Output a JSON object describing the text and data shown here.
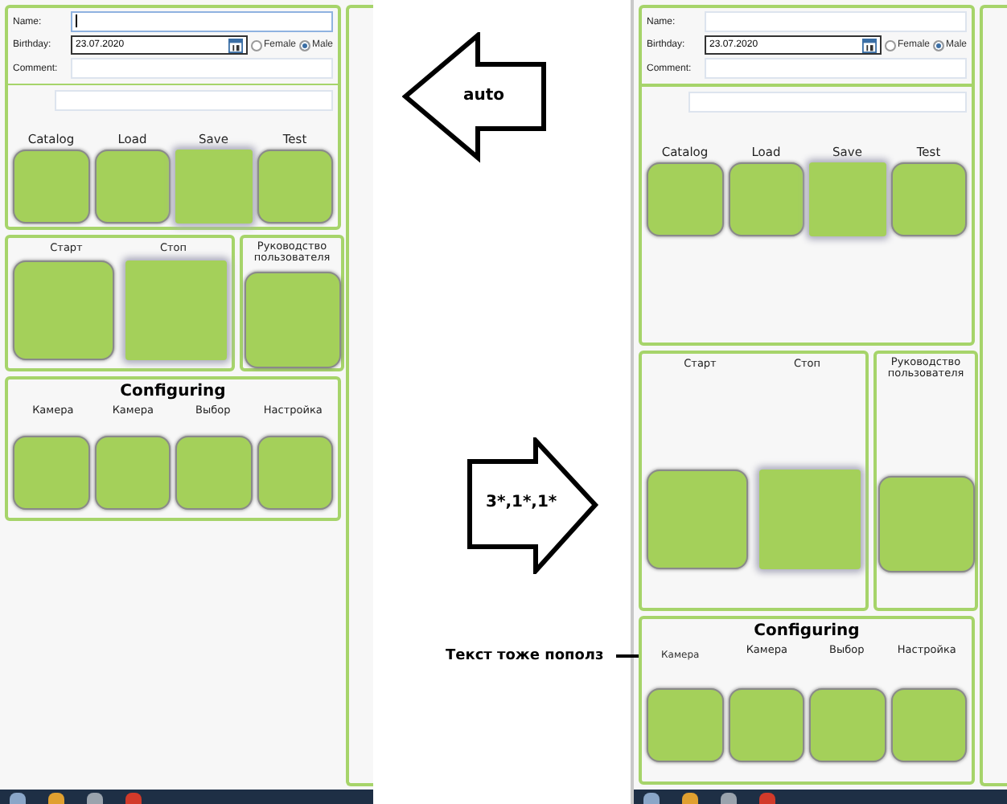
{
  "screens": [
    {
      "form": {
        "fields": [
          {
            "label": "Name:",
            "kind": "text",
            "focused": true
          },
          {
            "label": "Birthday:",
            "kind": "date",
            "value": "23.07.2020",
            "focused": false
          },
          {
            "label": "Comment:",
            "kind": "text",
            "focused": false
          }
        ],
        "gender": [
          {
            "label": "Female",
            "selected": false
          },
          {
            "label": "Male",
            "selected": true
          }
        ]
      },
      "top_buttons": [
        {
          "label": "Catalog",
          "disabled": false
        },
        {
          "label": "Load",
          "disabled": false
        },
        {
          "label": "Save",
          "disabled": true
        },
        {
          "label": "Test",
          "disabled": false
        }
      ],
      "run_buttons": [
        {
          "label": "Старт",
          "disabled": false
        },
        {
          "label": "Стоп",
          "disabled": true
        }
      ],
      "manual_button": {
        "label": "Руководство пользователя"
      },
      "configuring": {
        "title": "Configuring",
        "buttons": [
          {
            "label": "Камера",
            "shifted": false
          },
          {
            "label": "Камера",
            "shifted": false
          },
          {
            "label": "Выбор",
            "shifted": false
          },
          {
            "label": "Настройка",
            "shifted": false
          }
        ]
      }
    },
    {
      "form": {
        "fields": [
          {
            "label": "Name:",
            "kind": "text",
            "focused": false
          },
          {
            "label": "Birthday:",
            "kind": "date",
            "value": "23.07.2020",
            "focused": false
          },
          {
            "label": "Comment:",
            "kind": "text",
            "focused": false
          }
        ],
        "gender": [
          {
            "label": "Female",
            "selected": false
          },
          {
            "label": "Male",
            "selected": true
          }
        ]
      },
      "top_buttons": [
        {
          "label": "Catalog",
          "disabled": false
        },
        {
          "label": "Load",
          "disabled": false
        },
        {
          "label": "Save",
          "disabled": true
        },
        {
          "label": "Test",
          "disabled": false
        }
      ],
      "run_buttons": [
        {
          "label": "Старт",
          "disabled": false
        },
        {
          "label": "Стоп",
          "disabled": true
        }
      ],
      "manual_button": {
        "label": "Руководство пользователя"
      },
      "configuring": {
        "title": "Configuring",
        "buttons": [
          {
            "label": "Камера",
            "shifted": true
          },
          {
            "label": "Камера",
            "shifted": false
          },
          {
            "label": "Выбор",
            "shifted": false
          },
          {
            "label": "Настройка",
            "shifted": false
          }
        ]
      }
    }
  ],
  "annotations": [
    {
      "kind": "arrow-left",
      "text": "auto"
    },
    {
      "kind": "arrow-right",
      "text": "3*,1*,1*"
    },
    {
      "kind": "note",
      "text": "Текст тоже пополз"
    }
  ]
}
